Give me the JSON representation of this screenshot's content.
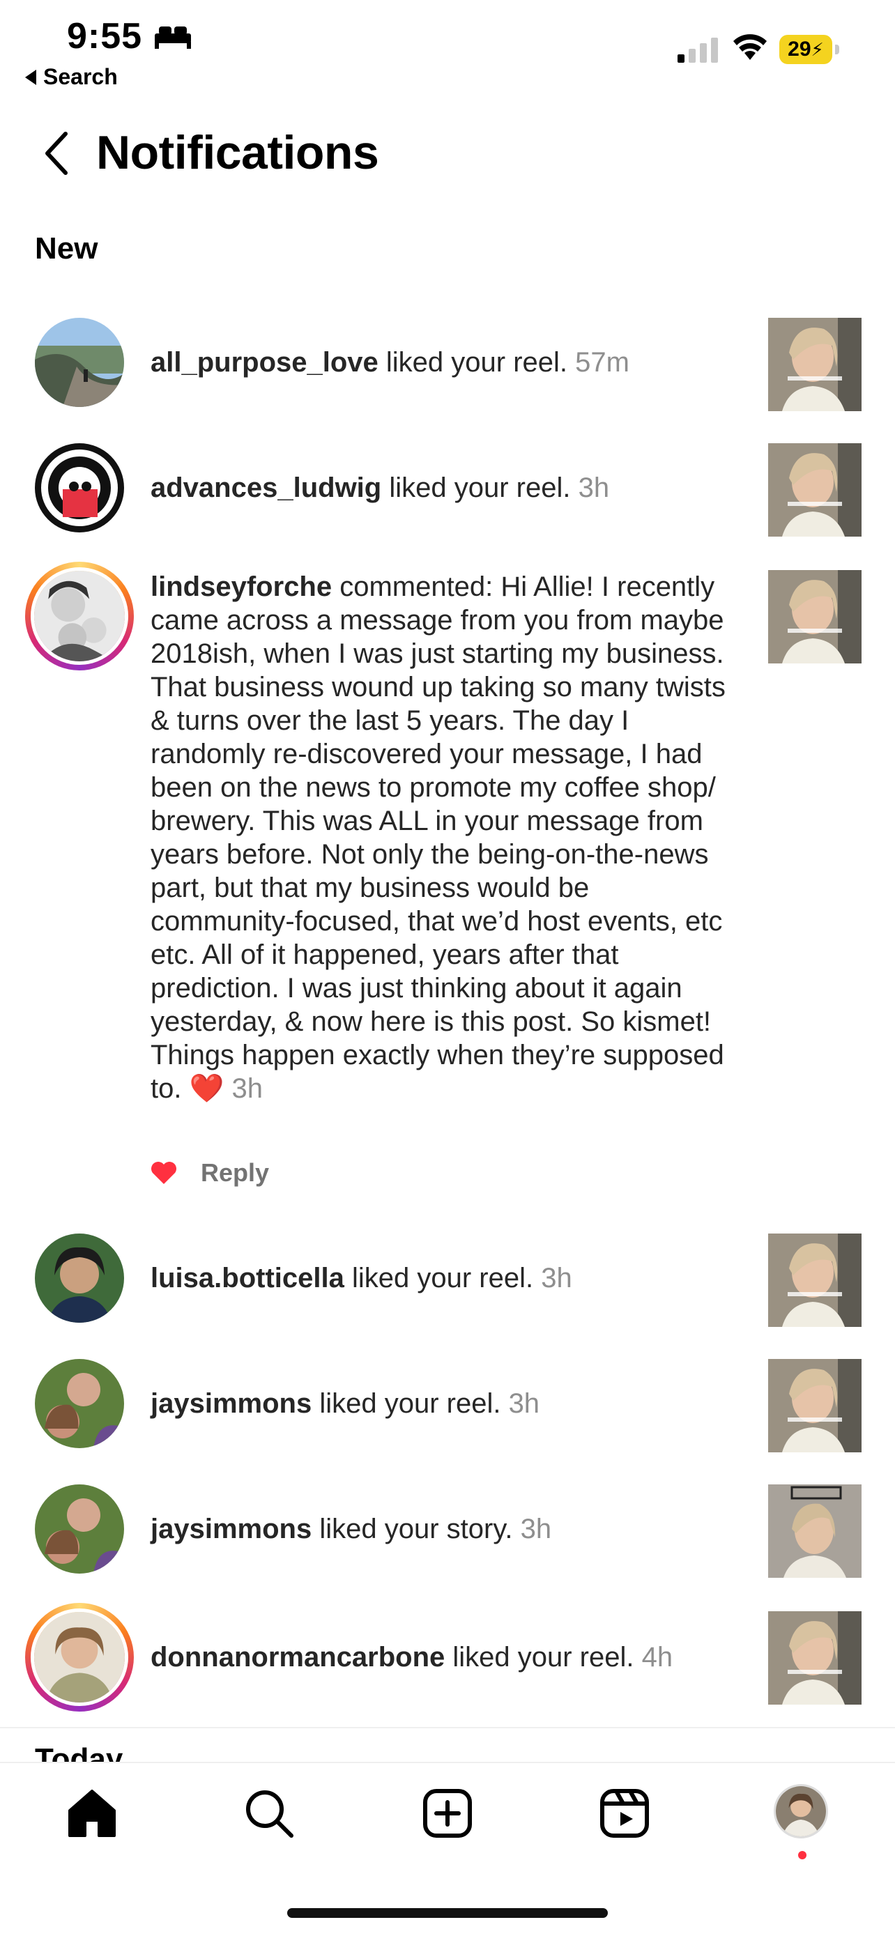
{
  "status_bar": {
    "time": "9:55",
    "back_app": "Search",
    "battery": "29"
  },
  "header": {
    "title": "Notifications"
  },
  "sections": {
    "new": "New",
    "today": "Today"
  },
  "notifications": [
    {
      "username": "all_purpose_love",
      "action": " liked your reel. ",
      "time": "57m",
      "avatar_icon": "cliff-landscape-avatar",
      "thumb": "reel-thumbnail"
    },
    {
      "username": "advances_ludwig",
      "action": " liked your reel. ",
      "time": "3h",
      "avatar_icon": "at-sign-skull-avatar",
      "thumb": "reel-thumbnail"
    },
    {
      "username": "lindseyforche",
      "action": " commented: Hi Allie! I recently came across a message from you from maybe 2018ish, when I was just starting my business. That business wound up taking so many twists & turns over the last 5 years. The day I randomly re-discovered your message, I had been on the news to promote my coffee shop/ brewery. This was ALL in your message from years before. Not only the being-on-the-news part, but that my business would be community-focused, that we’d host events, etc etc. All of it happened, years after that prediction. I was just thinking about it again yesterday, & now here is this post. So kismet! Things happen exactly when they’re supposed to. ❤️ ",
      "time": "3h",
      "avatar_icon": "family-photo-avatar",
      "thumb": "reel-thumbnail",
      "reply_label": "Reply"
    },
    {
      "username": "luisa.botticella",
      "action": " liked your reel. ",
      "time": "3h",
      "avatar_icon": "portrait-avatar",
      "thumb": "reel-thumbnail"
    },
    {
      "username": "jaysimmons",
      "action": " liked your reel. ",
      "time": "3h",
      "avatar_icon": "selfie-avatar",
      "thumb": "reel-thumbnail"
    },
    {
      "username": "jaysimmons",
      "action": " liked your story. ",
      "time": "3h",
      "avatar_icon": "selfie-avatar",
      "thumb": "story-thumbnail"
    },
    {
      "username": "donnanormancarbone",
      "action": " liked your reel. ",
      "time": "4h",
      "avatar_icon": "portrait-avatar",
      "thumb": "reel-thumbnail"
    }
  ],
  "tabbar": {
    "items": [
      "home-icon",
      "search-icon",
      "create-icon",
      "reels-icon",
      "profile-avatar"
    ],
    "accent": "#ff3040"
  }
}
